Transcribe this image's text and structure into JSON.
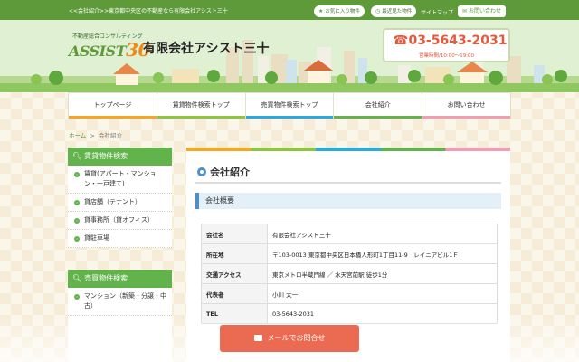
{
  "topbar": {
    "tagline": "<<会社紹介>>東京都中央区の不動産なら有限会社アシスト三十",
    "favorites_label": "お気に入り物件",
    "recent_label": "最近見た物件",
    "sitemap_label": "サイトマップ",
    "contact_label": "お問い合わせ"
  },
  "header": {
    "logo_tagline": "不動産総合コンサルティング",
    "logo_text": "ASSIST",
    "logo_number": "30",
    "company_name": "有限会社アシスト三十",
    "phone": "03-5643-2031",
    "hours": "営業時間/10:00～19:00"
  },
  "nav": [
    {
      "label": "トップページ"
    },
    {
      "label": "賃貸物件検索トップ"
    },
    {
      "label": "売買物件検索トップ"
    },
    {
      "label": "会社紹介"
    },
    {
      "label": "お問い合わせ"
    }
  ],
  "breadcrumb": {
    "home": "ホーム",
    "sep": ">",
    "current": "会社紹介"
  },
  "sidebar": {
    "rental": {
      "title": "賃貸物件検索",
      "items": [
        {
          "label": "賃貸(アパート・マンション・一戸建て)"
        },
        {
          "label": "貸店舗（テナント）"
        },
        {
          "label": "貸事務所（貸オフィス）"
        },
        {
          "label": "貸駐車場"
        }
      ]
    },
    "sale": {
      "title": "売買物件検索",
      "items": [
        {
          "label": "マンション（新築・分譲・中古）"
        }
      ]
    }
  },
  "main": {
    "title": "会社紹介",
    "section": "会社概要",
    "rows": [
      {
        "key": "会社名",
        "value": "有限会社アシスト三十"
      },
      {
        "key": "所在地",
        "value": "〒103-0013 東京都中央区日本橋人形町1丁目11-9　レイニアビル1Ｆ"
      },
      {
        "key": "交通アクセス",
        "value": "東京メトロ半蔵門線 ／ 水天宮前駅 徒歩1分"
      },
      {
        "key": "代表者",
        "value": "小川 太一"
      },
      {
        "key": "TEL",
        "value": "03-5643-2031"
      }
    ]
  },
  "mail_button": {
    "label": "メールでお問合せ"
  },
  "colors": {
    "green": "#62b34c",
    "orange_red": "#e55a3c",
    "blue": "#4e8fc7",
    "button": "#ea6b52"
  }
}
